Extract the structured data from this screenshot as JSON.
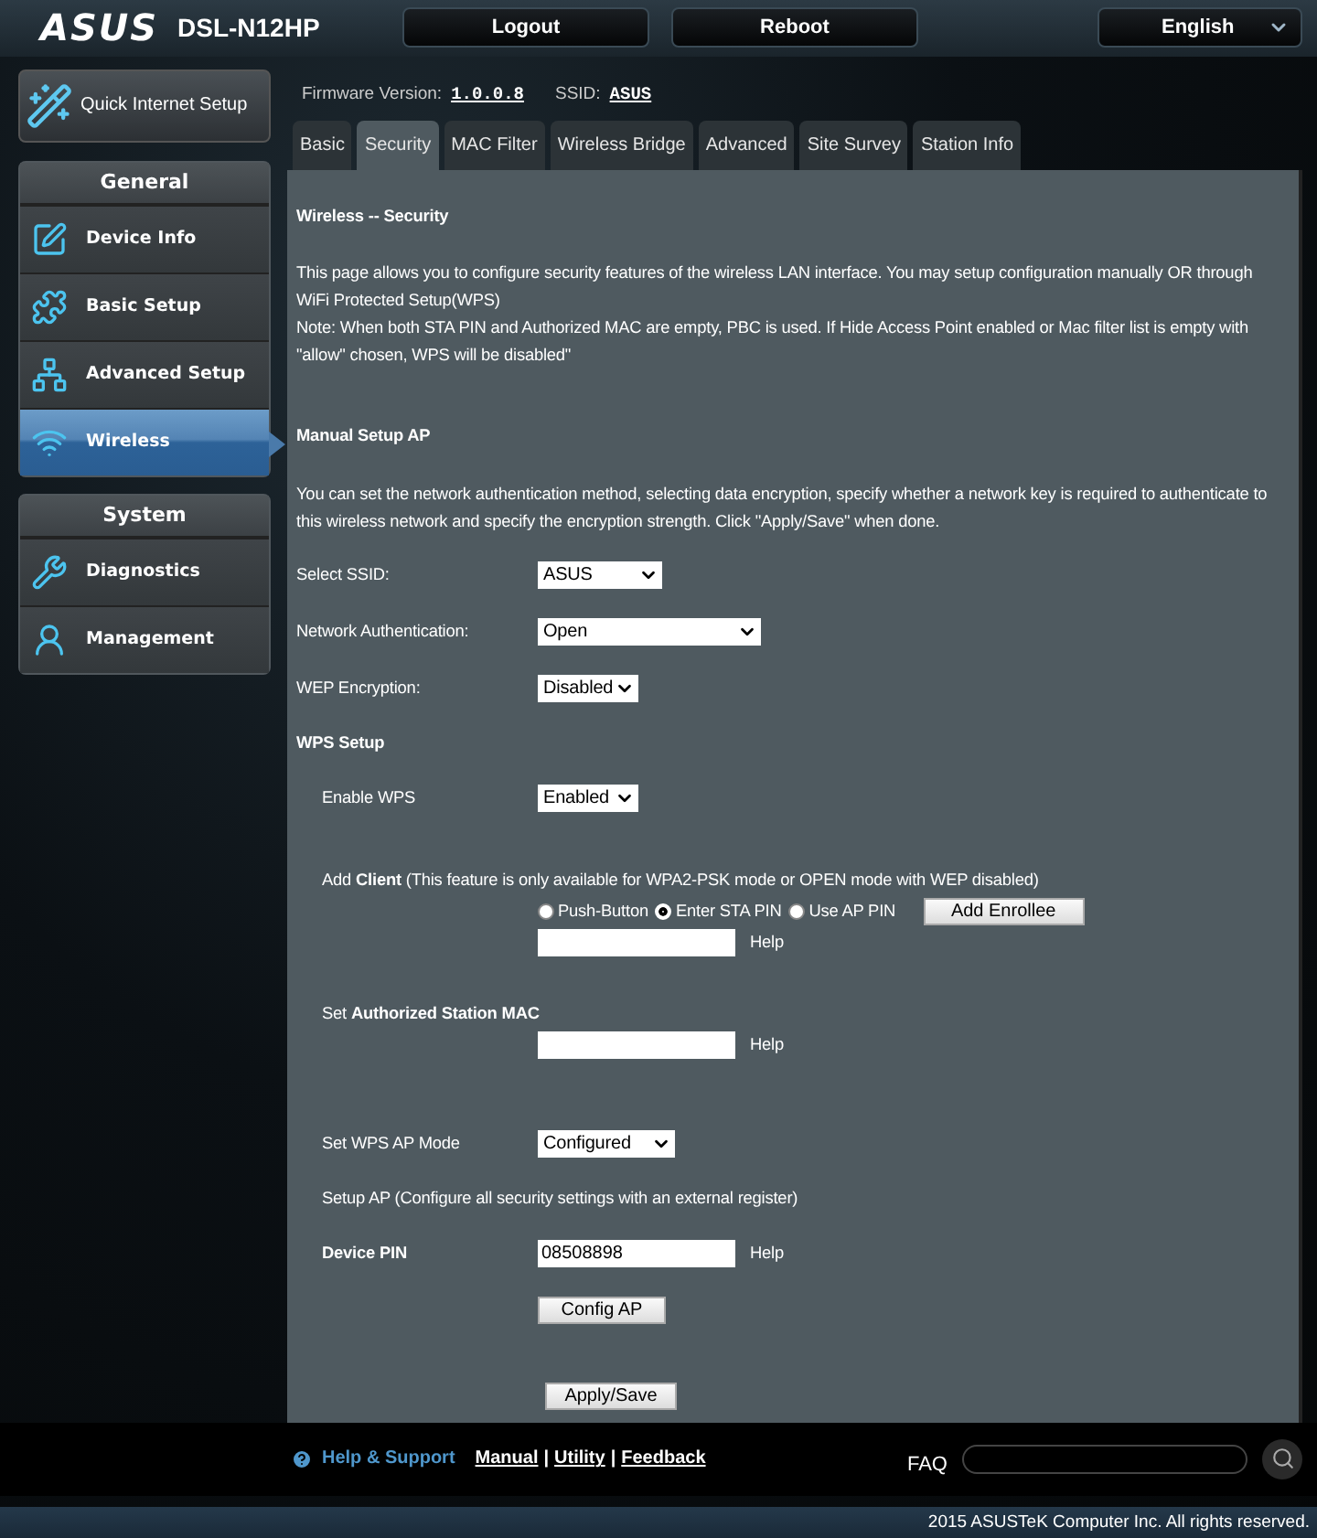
{
  "header": {
    "logo": "ASUS",
    "model": "DSL-N12HP",
    "buttons": [
      "Logout",
      "Reboot"
    ],
    "language": "English"
  },
  "quick_setup": "Quick Internet Setup",
  "sidebar": [
    {
      "title": "General",
      "items": [
        {
          "label": "Device Info",
          "kind": "info",
          "selected": false
        },
        {
          "label": "Basic Setup",
          "kind": "basic",
          "selected": false
        },
        {
          "label": "Advanced Setup",
          "kind": "advanced",
          "selected": false
        },
        {
          "label": "Wireless",
          "kind": "wireless",
          "selected": true
        }
      ]
    },
    {
      "title": "System",
      "items": [
        {
          "label": "Diagnostics",
          "kind": "diagnostics",
          "selected": false
        },
        {
          "label": "Management",
          "kind": "management",
          "selected": false
        }
      ]
    }
  ],
  "firmware": {
    "label": "Firmware Version:",
    "version": "1.0.0.8",
    "ssid_label": "SSID:",
    "ssid": "ASUS"
  },
  "tabs": [
    {
      "label": "Basic",
      "selected": false
    },
    {
      "label": "Security",
      "selected": true
    },
    {
      "label": "MAC Filter",
      "selected": false
    },
    {
      "label": "Wireless Bridge",
      "selected": false
    },
    {
      "label": "Advanced",
      "selected": false
    },
    {
      "label": "Site Survey",
      "selected": false
    },
    {
      "label": "Station Info",
      "selected": false
    }
  ],
  "page": {
    "title": "Wireless -- Security",
    "intro": [
      "This page allows you to configure security features of the wireless LAN interface. You may setup configuration manually OR through WiFi Protected Setup(WPS)",
      "Note: When both STA PIN and Authorized MAC are empty, PBC is used. If Hide Access Point enabled or Mac filter list is empty with \"allow\" chosen, WPS will be disabled\""
    ],
    "manual_title": "Manual Setup AP",
    "manual_text": "You can set the network authentication method, selecting data encryption, specify whether a network key is required to authenticate to this wireless network and specify the encryption strength. Click \"Apply/Save\" when done.",
    "fields": [
      {
        "label": "Select SSID:",
        "value": "ASUS"
      },
      {
        "label": "Network Authentication:",
        "value": "Open"
      },
      {
        "label": "WEP Encryption:",
        "value": "Disabled"
      }
    ],
    "wps_title": "WPS Setup",
    "enable_wps": {
      "label": "Enable WPS",
      "value": "Enabled"
    },
    "add_client": {
      "text": "Add **Client** (This feature is only available for WPA2-PSK mode or OPEN mode with WEP disabled)",
      "radios": [
        {
          "label": "Push-Button",
          "selected": false
        },
        {
          "label": "Enter STA PIN",
          "selected": true
        },
        {
          "label": "Use AP PIN",
          "selected": false
        }
      ],
      "button": "Add Enrollee",
      "help": "Help"
    },
    "mac": {
      "label": "Set **Authorized Station MAC**",
      "help": "Help"
    },
    "ap_mode": {
      "label": "Set WPS AP Mode",
      "value": "Configured"
    },
    "setup_ap": "Setup AP (Configure all security settings with an external register)",
    "device_pin": {
      "label": "Device PIN",
      "value": "08508898",
      "help": "Help"
    },
    "config_button": "Config AP",
    "apply_button": "Apply/Save"
  },
  "footer": {
    "help": "Help & Support",
    "links": [
      "Manual",
      "Utility",
      "Feedback"
    ],
    "separator": "|",
    "faq": "FAQ"
  },
  "copyright": "2015 ASUSTeK Computer Inc. All rights reserved."
}
